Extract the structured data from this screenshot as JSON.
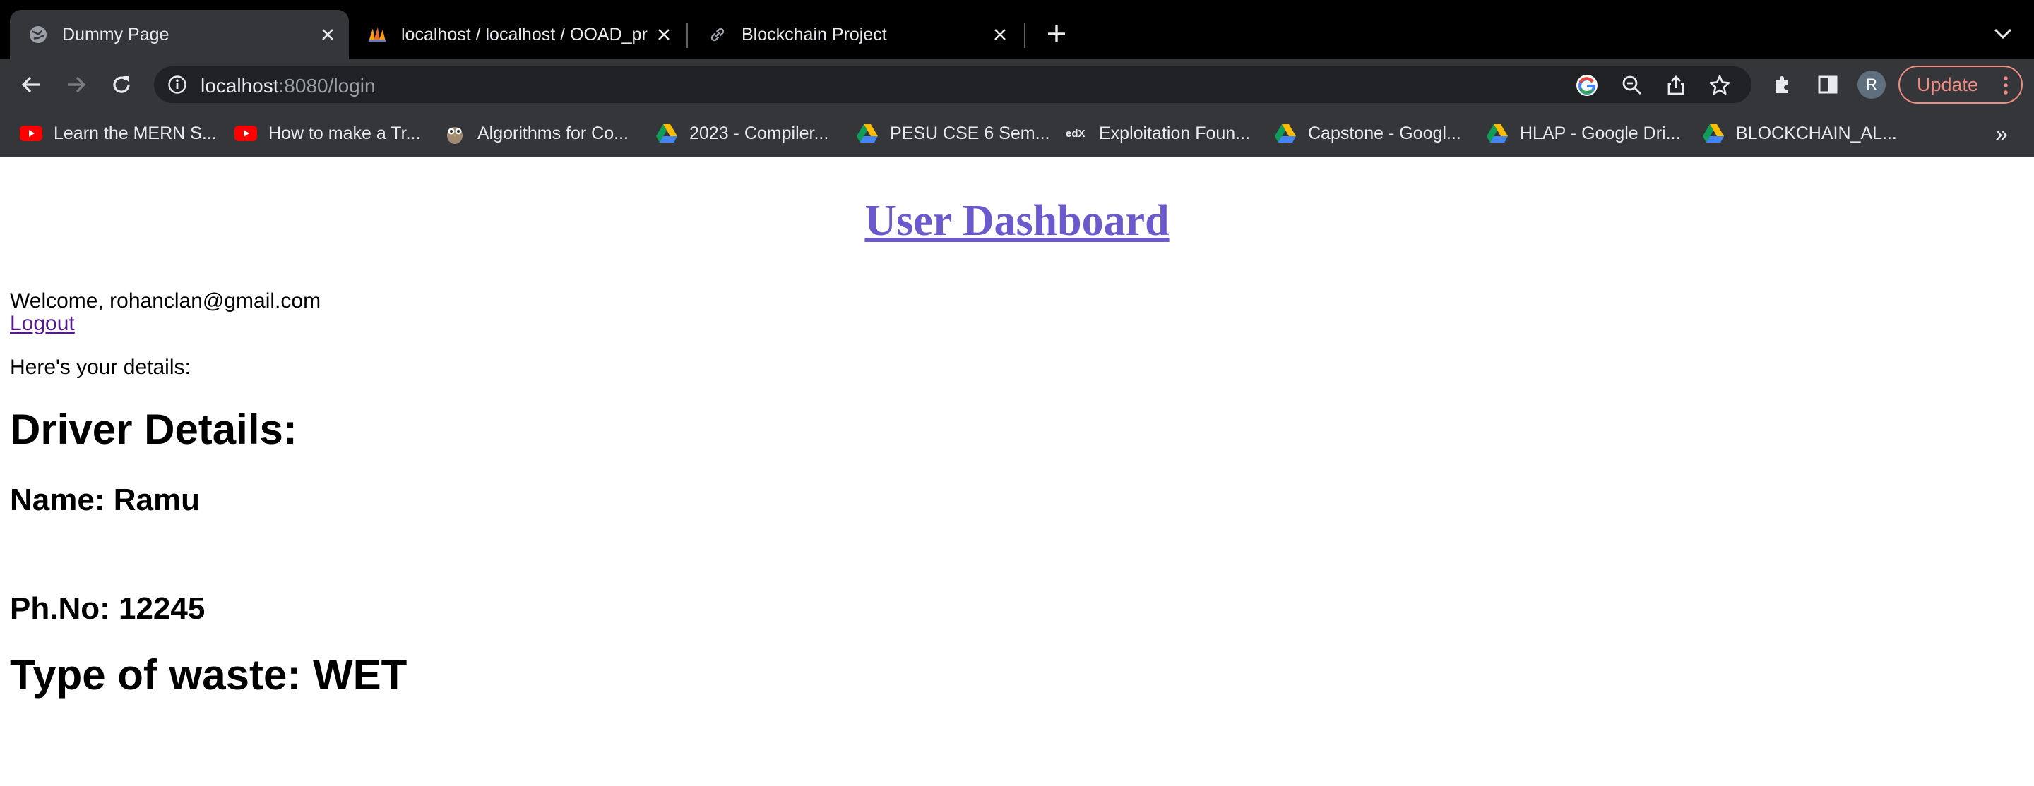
{
  "browser": {
    "tabs": [
      {
        "title": "Dummy Page",
        "icon": "globe-icon",
        "active": true
      },
      {
        "title": "localhost / localhost / OOAD_pr",
        "icon": "phpmyadmin-icon",
        "active": false
      },
      {
        "title": "Blockchain Project",
        "icon": "link-icon",
        "active": false
      }
    ],
    "address": {
      "host": "localhost",
      "path": ":8080/login"
    },
    "profile_initial": "R",
    "update_label": "Update",
    "bookmarks": [
      {
        "label": "Learn the MERN S...",
        "icon": "youtube-icon"
      },
      {
        "label": "How to make a Tr...",
        "icon": "youtube-icon"
      },
      {
        "label": "Algorithms for Co...",
        "icon": "owl-icon"
      },
      {
        "label": "2023 - Compiler...",
        "icon": "google-drive-icon"
      },
      {
        "label": "PESU CSE 6 Sem...",
        "icon": "google-drive-icon"
      },
      {
        "label": "Exploitation Foun...",
        "icon": "edx-icon"
      },
      {
        "label": "Capstone - Googl...",
        "icon": "google-drive-icon"
      },
      {
        "label": "HLAP - Google Dri...",
        "icon": "google-drive-icon"
      },
      {
        "label": "BLOCKCHAIN_AL...",
        "icon": "google-drive-icon"
      }
    ],
    "bookmarks_overflow": "»"
  },
  "page": {
    "title": "User Dashboard",
    "welcome": "Welcome, rohanclan@gmail.com",
    "logout_label": "Logout",
    "details_intro": "Here's your details:",
    "driver_heading": "Driver Details:",
    "name_line": "Name: Ramu",
    "phone_line": "Ph.No: 12245",
    "waste_line": "Type of waste: WET"
  },
  "colors": {
    "title_link": "#6a5acd",
    "visited_link": "#551a8b",
    "update_accent": "#f28b82",
    "chrome_dark": "#35363a"
  }
}
